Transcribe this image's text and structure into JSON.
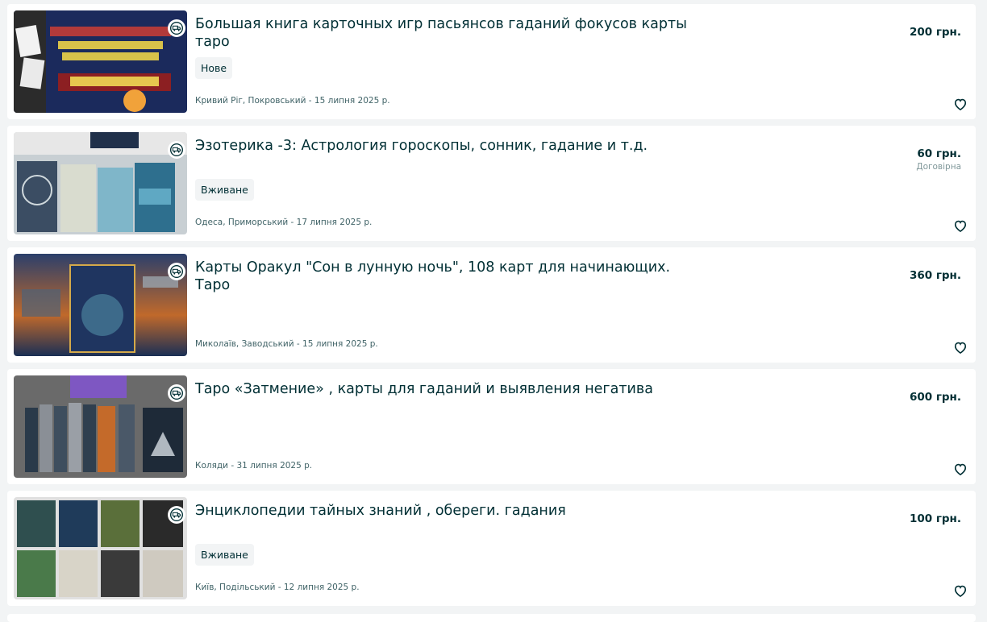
{
  "listings": [
    {
      "title": "Большая книга карточных игр пасьянсов гаданий фокусов карты таро",
      "badge": "Нове",
      "location": "Кривий Ріг, Покровський - 15 липня 2025 р.",
      "price": "200 грн.",
      "negotiable": "",
      "thumb_colors": [
        "#1b2a5c",
        "#8c1f22",
        "#d8c24a"
      ]
    },
    {
      "title": "Эзотерика -3: Астрология гороскопы, сонник, гадание и т.д.",
      "badge": "Вживане",
      "location": "Одеса, Приморський - 17 липня 2025 р.",
      "price": "60 грн.",
      "negotiable": "Договірна",
      "thumb_colors": [
        "#2e6f8e",
        "#c8d6c9",
        "#3b4d63"
      ]
    },
    {
      "title": "Карты Оракул \"Сон в лунную ночь\", 108 карт для начинающих. Таро",
      "badge": "",
      "location": "Миколаїв, Заводський - 15 липня 2025 р.",
      "price": "360 грн.",
      "negotiable": "",
      "thumb_colors": [
        "#1a2f55",
        "#c0692b",
        "#3d6a8a"
      ]
    },
    {
      "title": "Таро «Затмение» , карты для гаданий и выявления негатива",
      "badge": "",
      "location": "Коляди - 31 липня 2025 р.",
      "price": "600 грн.",
      "negotiable": "",
      "thumb_colors": [
        "#6a6a6a",
        "#7e57c2",
        "#2a3a4a"
      ]
    },
    {
      "title": "Энциклопедии тайных знаний , обереги. гадания",
      "badge": "Вживане",
      "location": "Київ, Подільський - 12 липня 2025 р.",
      "price": "100 грн.",
      "negotiable": "",
      "thumb_colors": [
        "#2f4f4f",
        "#e0e0e0",
        "#1f3b5a"
      ]
    }
  ],
  "icons": {
    "delivery": "delivery-truck-icon",
    "favorite": "heart-outline-icon"
  }
}
